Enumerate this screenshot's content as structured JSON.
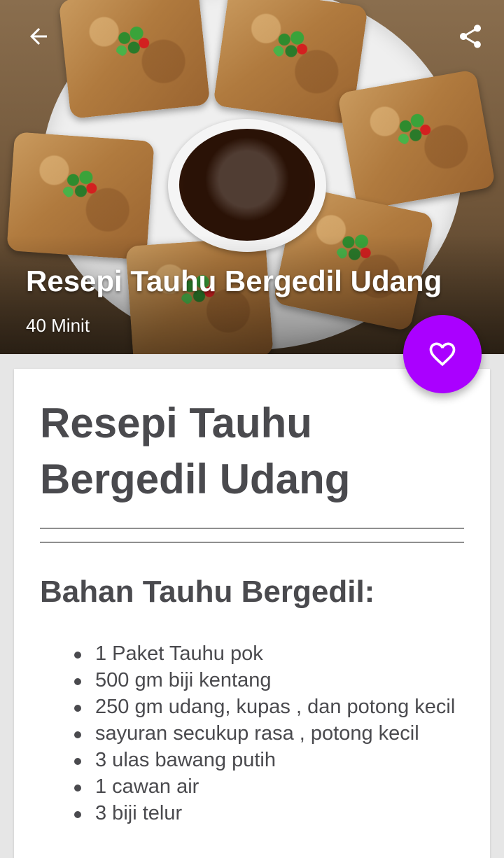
{
  "hero": {
    "title": "Resepi Tauhu Bergedil Udang",
    "time": "40 Minit"
  },
  "toolbar": {
    "back_icon": "arrow-left-icon",
    "share_icon": "share-icon"
  },
  "fab": {
    "icon": "heart-outline-icon",
    "color": "#aa00ff"
  },
  "content": {
    "title": "Resepi Tauhu Bergedil Udang",
    "section_title": "Bahan Tauhu Bergedil:",
    "ingredients": [
      "1 Paket Tauhu pok",
      "500 gm biji kentang",
      "250 gm udang, kupas , dan potong kecil",
      "sayuran secukup rasa , potong kecil",
      "3 ulas bawang putih",
      "1 cawan air",
      "3 biji telur"
    ]
  }
}
